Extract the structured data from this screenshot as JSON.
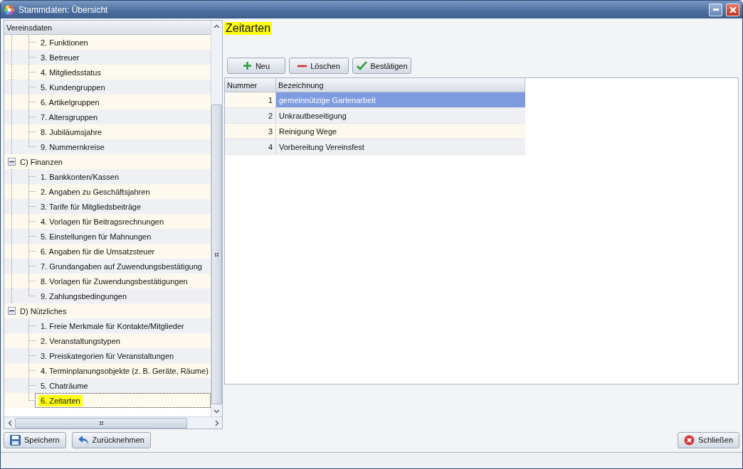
{
  "window": {
    "title": "Stammdaten: Übersicht"
  },
  "tree": {
    "header": "Vereinsdaten",
    "groups": [
      {
        "children": [
          {
            "label": "2. Funktionen",
            "selected": false
          },
          {
            "label": "3. Betreuer",
            "selected": false
          },
          {
            "label": "4. Mitgliedsstatus",
            "selected": false
          },
          {
            "label": "5. Kundengruppen",
            "selected": false
          },
          {
            "label": "6. Artikelgruppen",
            "selected": false
          },
          {
            "label": "7. Altersgruppen",
            "selected": false
          },
          {
            "label": "8. Jubiläumsjahre",
            "selected": false
          },
          {
            "label": "9. Nummernkreise",
            "selected": false
          }
        ]
      },
      {
        "label": "C) Finanzen",
        "expanded": true,
        "children": [
          {
            "label": "1. Bankkonten/Kassen",
            "selected": false
          },
          {
            "label": "2. Angaben zu Geschäftsjahren",
            "selected": false
          },
          {
            "label": "3. Tarife für Mitgliedsbeiträge",
            "selected": false
          },
          {
            "label": "4. Vorlagen für Beitragsrechnungen",
            "selected": false
          },
          {
            "label": "5. Einstellungen für Mahnungen",
            "selected": false
          },
          {
            "label": "6. Angaben für die Umsatzsteuer",
            "selected": false
          },
          {
            "label": "7. Grundangaben auf Zuwendungsbestätigung",
            "selected": false
          },
          {
            "label": "8. Vorlagen für Zuwendungsbestätigungen",
            "selected": false
          },
          {
            "label": "9. Zahlungsbedingungen",
            "selected": false
          }
        ]
      },
      {
        "label": "D) Nützliches",
        "expanded": true,
        "children": [
          {
            "label": "1. Freie Merkmale für Kontakte/Mitglieder",
            "selected": false
          },
          {
            "label": "2. Veranstaltungstypen",
            "selected": false
          },
          {
            "label": "3. Preiskategorien für Veranstaltungen",
            "selected": false
          },
          {
            "label": "4. Terminplanungsobjekte (z. B. Geräte, Räume)",
            "selected": false
          },
          {
            "label": "5. Chaträume",
            "selected": false
          },
          {
            "label": "6. Zeitarten",
            "selected": true
          }
        ]
      }
    ]
  },
  "detail": {
    "title": "Zeitarten",
    "toolbar": [
      {
        "kind": "add",
        "label": "Neu"
      },
      {
        "kind": "delete",
        "label": "Löschen"
      },
      {
        "kind": "confirm",
        "label": "Bestätigen"
      }
    ],
    "table": {
      "columns": [
        "Nummer",
        "Bezeichnung"
      ],
      "rows": [
        {
          "number": "1",
          "name": "gemeinnützige Gartenarbeit",
          "selected": true
        },
        {
          "number": "2",
          "name": "Unkrautbeseitigung",
          "selected": false
        },
        {
          "number": "3",
          "name": "Reinigung Wege",
          "selected": false
        },
        {
          "number": "4",
          "name": "Vorbereitung Vereinsfest",
          "selected": false
        }
      ]
    }
  },
  "footer": {
    "left_buttons": [
      {
        "kind": "save",
        "label": "Speichern"
      },
      {
        "kind": "undo",
        "label": "Zurücknehmen"
      }
    ],
    "right_buttons": [
      {
        "kind": "close",
        "label": "Schließen"
      }
    ]
  }
}
